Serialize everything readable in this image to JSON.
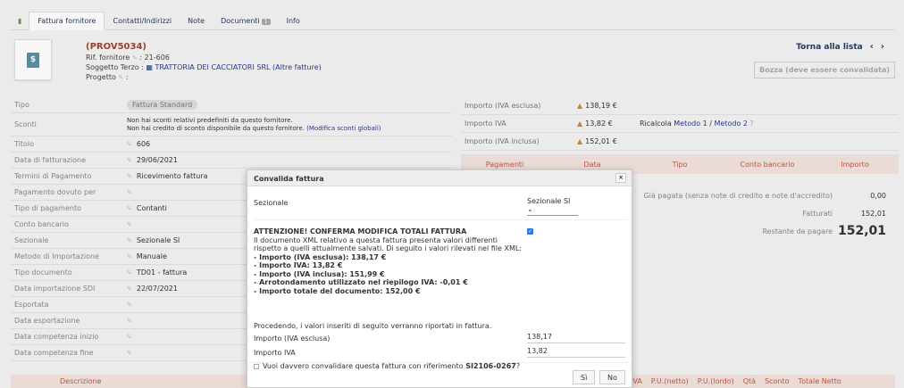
{
  "tabs": [
    {
      "label": "Fattura fornitore"
    },
    {
      "label": "Contatti/Indirizzi"
    },
    {
      "label": "Note"
    },
    {
      "label": "Documenti",
      "badge": "1"
    },
    {
      "label": "Info"
    }
  ],
  "header": {
    "ref": "(PROV5034)",
    "rif_label": "Rif. fornitore",
    "rif_value": ": 21-606",
    "soggetto_label": "Soggetto Terzo : ",
    "soggetto_value": "TRATTORIA DEI CACCIATORI SRL",
    "altre": "(Altre fatture)",
    "progetto_label": "Progetto",
    "progetto_value": ":",
    "back": "Torna alla lista",
    "status": "Bozza (deve essere convalidata)"
  },
  "fields": {
    "tipo_label": "Tipo",
    "tipo_value": "Fattura Standard",
    "sconti_label": "Sconti",
    "sconti_note1": "Non hai sconti relativi predefiniti da questo fornitore.",
    "sconti_note2": "Non hai credito di sconto disponibile da questo fornitore.",
    "sconti_link": "(Modifica sconti globali)",
    "titolo_label": "Titolo",
    "titolo_value": "606",
    "data_label": "Data di fatturazione",
    "data_value": "29/06/2021",
    "termini_label": "Termini di Pagamento",
    "termini_value": "Ricevimento fattura",
    "dovuto_label": "Pagamento dovuto per",
    "tipopag_label": "Tipo di pagamento",
    "tipopag_value": "Contanti",
    "conto_label": "Conto bancario",
    "sezionale_label": "Sezionale",
    "sezionale_value": "Sezionale SI",
    "metodo_label": "Metodo di Importazione",
    "metodo_value": "Manuale",
    "tipodoc_label": "Tipo documento",
    "tipodoc_value": "TD01 - fattura",
    "sdi_label": "Data importazione SDI",
    "sdi_value": "22/07/2021",
    "esportata_label": "Esportata",
    "dataesp_label": "Data esportazione",
    "compin_label": "Data competenza inizio",
    "compfin_label": "Data competenza fine"
  },
  "amounts": {
    "escl_label": "Importo (IVA esclusa)",
    "escl_value": "138,19 €",
    "iva_label": "Importo IVA",
    "iva_value": "13,82 €",
    "ricalcola": "Ricalcola",
    "metodo1": "Metodo 1",
    "slash": " / ",
    "metodo2": "Metodo 2",
    "incl_label": "Importo (IVA inclusa)",
    "incl_value": "152,01 €",
    "pay_headers": [
      "Pagamenti",
      "Data",
      "Tipo",
      "Conto bancario",
      "Importo"
    ],
    "gia_label": "Già pagata (senza note di credito e note d'accredito)",
    "gia_value": "0,00",
    "fatturati_label": "Fatturati",
    "fatturati_value": "152,01",
    "restante_label": "Restante da pagare",
    "restante_value": "152,01"
  },
  "bottom": {
    "descrizione": "Descrizione",
    "cols": [
      "IVA",
      "P.U.(netto)",
      "P.U.(lordo)",
      "Qtà",
      "Sconto",
      "Totale Netto"
    ]
  },
  "dialog": {
    "title": "Convalida fattura",
    "close": "×",
    "sezionale_label": "Sezionale",
    "sezionale_value": "Sezionale SI",
    "warn_title": "ATTENZIONE! CONFERMA MODIFICA TOTALI FATTURA",
    "warn_text": "Il documento XML relativo a questa fattura presenta valori differenti rispetto a quelli attualmente salvati. Di seguito i valori rilevati nel file XML:",
    "lines": [
      "- Importo (IVA esclusa): 138,17 €",
      "- Importo IVA: 13,82 €",
      "- Importo (IVA inclusa): 151,99 €",
      "- Arrotondamento utilizzato nel riepilogo IVA: -0,01 €",
      "- Importo totale del documento: 152,00 €"
    ],
    "procedendo": "Procedendo, i valori inseriti di seguito verranno riportati in fattura.",
    "escl_label": "Importo (IVA esclusa)",
    "escl_value": "138,17",
    "iva_label": "Importo IVA",
    "iva_value": "13,82",
    "confirm_text": "Vuoi davvero convalidare questa fattura con riferimento ",
    "confirm_ref": "SI2106-0267",
    "confirm_q": "?",
    "yes": "Sì",
    "no": "No"
  }
}
